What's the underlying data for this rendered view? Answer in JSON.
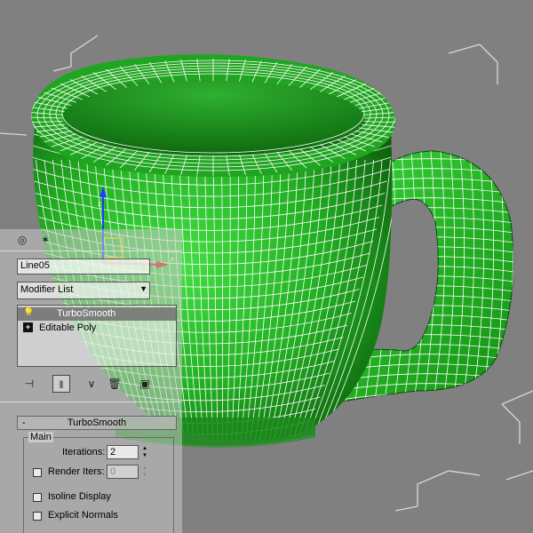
{
  "object_name": "Line05",
  "modifier_list": {
    "label": "Modifier List",
    "arrow_icon": "dropdown-arrow-icon"
  },
  "stack": [
    {
      "label": "TurboSmooth",
      "icon": "lightbulb-icon",
      "selected": true
    },
    {
      "label": "Editable Poly",
      "icon": "plus-expand-icon",
      "selected": false
    }
  ],
  "rollout": {
    "title": "TurboSmooth",
    "collapse_symbol": "-",
    "main_group": {
      "label": "Main",
      "iterations_label": "Iterations:",
      "iterations_value": "2",
      "render_iters_label": "Render Iters:",
      "render_iters_value": "0",
      "isoline_label": "Isoline Display",
      "explicit_normals_label": "Explicit Normals"
    }
  },
  "colors": {
    "viewport_bg": "#808080",
    "mesh_green": "#22b822",
    "mesh_dark": "#0e5a0e",
    "wire": "#ffffff",
    "gizmo_y": "#1a3cff",
    "gizmo_x": "#e01010",
    "gizmo_plane": "#f0e000"
  }
}
